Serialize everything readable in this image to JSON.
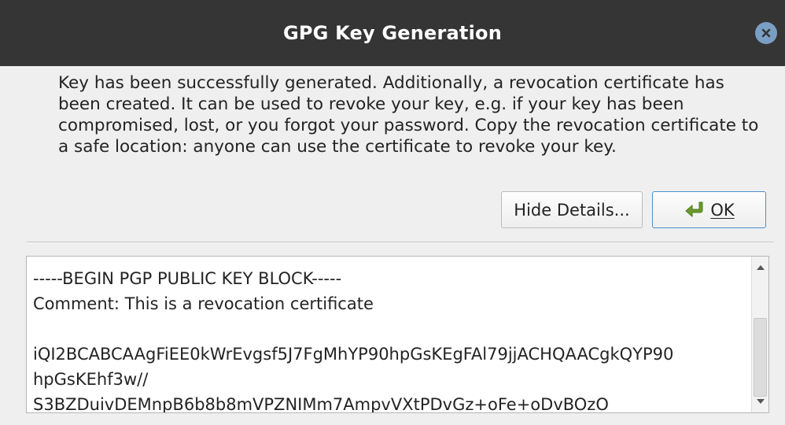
{
  "window": {
    "title": "GPG Key Generation",
    "close_icon": "close-icon"
  },
  "message": "Key has been successfully generated. Additionally, a revocation certificate has been created. It can be used to revoke your key, e.g. if your key has been compromised, lost, or you forgot your password. Copy the revocation certificate to a safe location: anyone can use the certificate to revoke your key.",
  "buttons": {
    "details_label": "Hide Details...",
    "ok_label": "OK",
    "ok_icon": "ok-arrow-icon"
  },
  "details": {
    "text": "-----BEGIN PGP PUBLIC KEY BLOCK-----\nComment: This is a revocation certificate\n\niQI2BCABCAAgFiEE0kWrEvgsf5J7FgMhYP90hpGsKEgFAl79jjACHQAACgkQYP90\nhpGsKEhf3w//\nS3BZDuivDEMnpB6b8b8mVPZNIMm7AmpvVXtPDvGz+oFe+oDvBOzO"
  },
  "colors": {
    "titlebar": "#353535",
    "close_button": "#7a9fc4",
    "focus_border": "#4a8fce",
    "ok_icon": "#6a9a2e"
  }
}
